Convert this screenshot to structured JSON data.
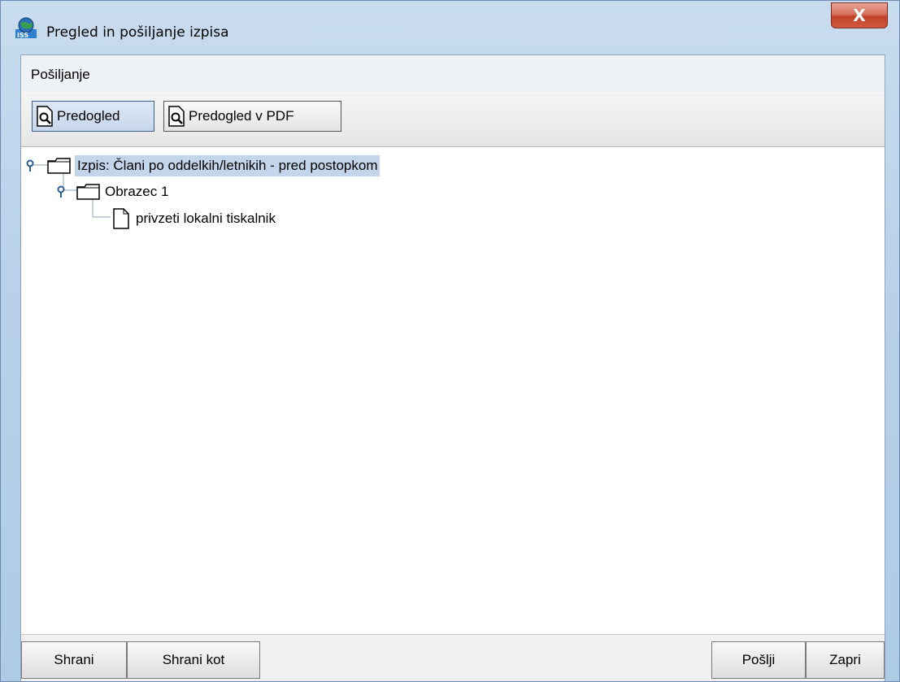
{
  "window": {
    "title": "Pregled in pošiljanje izpisa",
    "close_label": "X"
  },
  "menu": {
    "items": [
      "Pošiljanje"
    ]
  },
  "toolbar": {
    "preview_label": "Predogled",
    "preview_pdf_label": "Predogled v PDF"
  },
  "tree": {
    "root": {
      "label": "Izpis: Člani po oddelkih/letnikih - pred postopkom",
      "icon": "folder-icon",
      "selected": true
    },
    "child": {
      "label": "Obrazec 1",
      "icon": "folder-icon"
    },
    "leaf": {
      "label": "privzeti lokalni tiskalnik",
      "icon": "document-icon"
    }
  },
  "buttons": {
    "save": "Shrani",
    "save_as": "Shrani kot",
    "send": "Pošlji",
    "close": "Zapri"
  },
  "colors": {
    "selection": "#c3d5ea",
    "close_button": "#c0412a",
    "title_bar": "#b9d1ea"
  }
}
